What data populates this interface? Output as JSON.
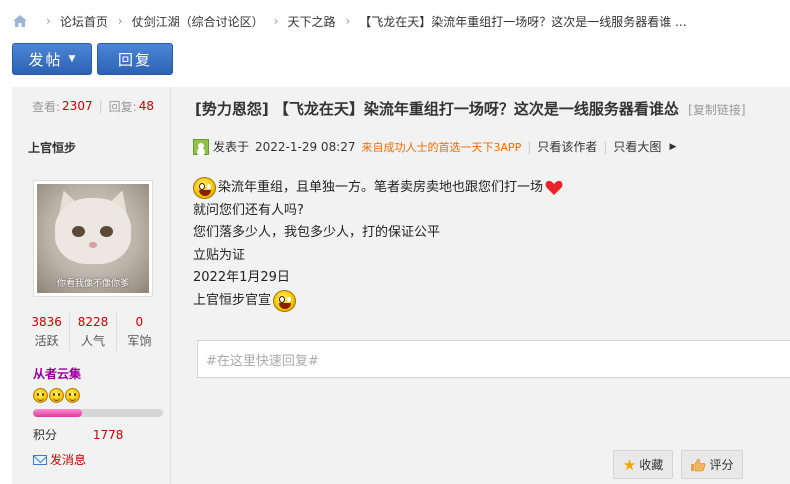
{
  "breadcrumb": {
    "items": [
      "论坛首页",
      "仗剑江湖（综合讨论区）",
      "天下之路",
      "【飞龙在天】染流年重组打一场呀？这次是一线服务器看谁 ..."
    ],
    "separator": "›"
  },
  "actions": {
    "post_label": "发帖",
    "reply_label": "回复"
  },
  "thread_stats": {
    "views_label": "查看:",
    "views": "2307",
    "replies_label": "回复:",
    "replies": "48"
  },
  "author": {
    "name": "上官恒步",
    "avatar_caption": "你看我像不像你爹",
    "stats": [
      {
        "value": "3836",
        "label": "活跃"
      },
      {
        "value": "8228",
        "label": "人气"
      },
      {
        "value": "0",
        "label": "军饷"
      }
    ],
    "group": "从者云集",
    "level_progress": 0.38,
    "points_label": "积分",
    "points": "1778",
    "message_label": "发消息"
  },
  "post": {
    "title": "[势力恩怨] 【飞龙在天】染流年重组打一场呀？这次是一线服务器看谁怂",
    "copy_link": "[复制链接]",
    "meta": {
      "posted_prefix": "发表于",
      "posted_time": "2022-1-29 08:27",
      "source": "来自成功人士的首选一天下3APP",
      "author_only": "只看该作者",
      "large_image": "只看大图"
    },
    "body_lines": [
      "染流年重组，且单独一方。笔者卖房卖地也跟您们打一场",
      "就问您们还有人吗?",
      "您们落多少人，我包多少人，打的保证公平",
      "立贴为证",
      "2022年1月29日",
      "上官恒步官宣"
    ]
  },
  "reply_box": {
    "placeholder": "#在这里快速回复#"
  },
  "footer_actions": {
    "favorite_label": "收藏",
    "rate_label": "评分"
  },
  "colors": {
    "accent_blue": "#2c62b4",
    "red": "#cc0000",
    "orange": "#f26c00",
    "purple": "#990099",
    "panel_bg": "#f2f2f2"
  }
}
